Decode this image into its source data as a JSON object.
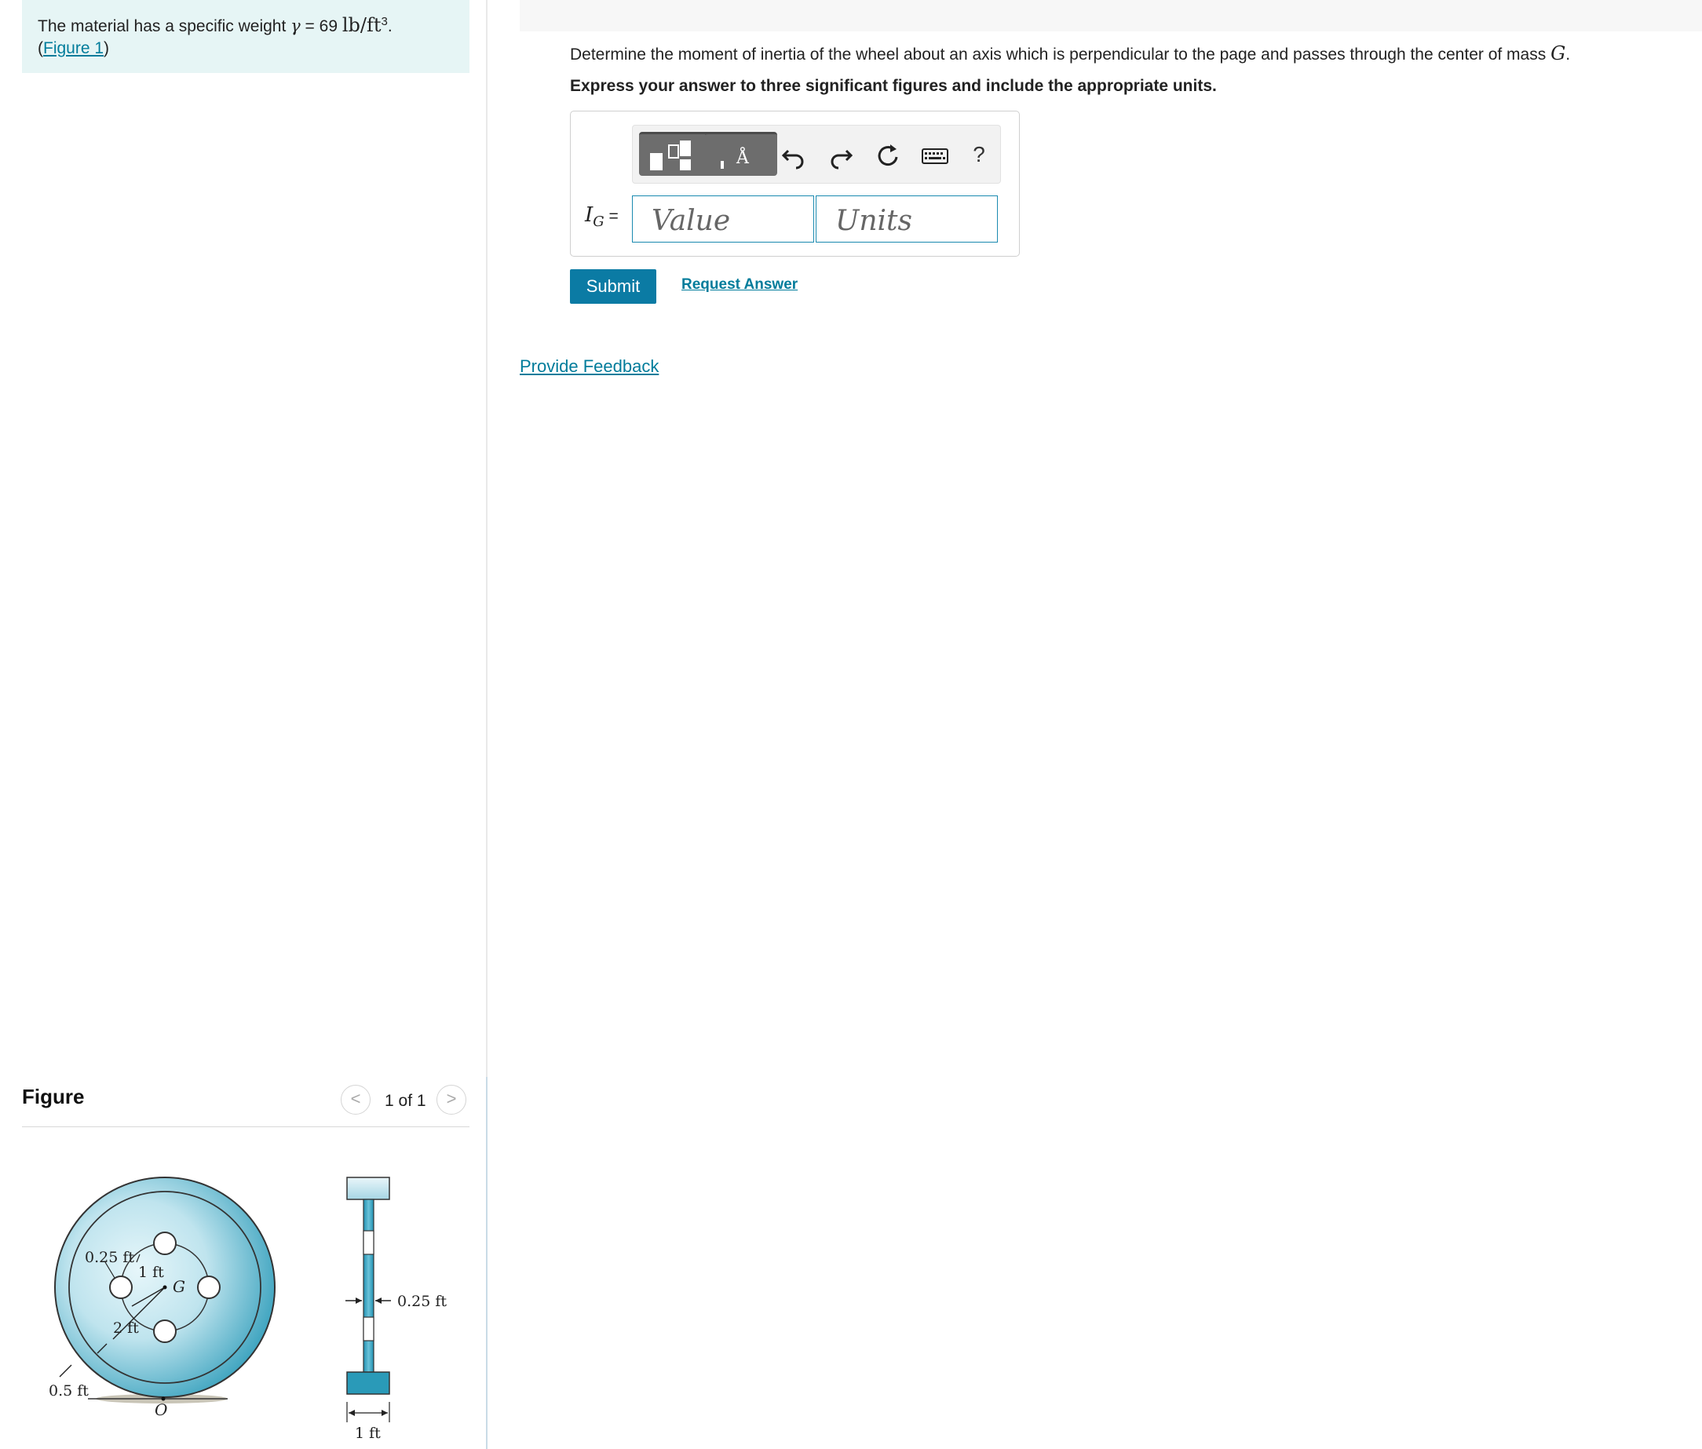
{
  "problem": {
    "text_prefix": "The material has a specific weight ",
    "gamma_symbol": "γ",
    "gamma_value": " = 69 ",
    "gamma_unit": "lb/ft",
    "gamma_exponent": "3",
    "period": ".",
    "figure_link_open": "(",
    "figure_link_text": "Figure 1",
    "figure_link_close": ")"
  },
  "question": {
    "text": "Determine the moment of inertia of the wheel about an axis which is perpendicular to the page and passes through the center of mass ",
    "symbol": "G",
    "end": ".",
    "instruction": "Express your answer to three significant figures and include the appropriate units."
  },
  "answer": {
    "label_main": "I",
    "label_sub": "G",
    "label_eq": " =",
    "value_placeholder": "Value",
    "units_placeholder": "Units"
  },
  "toolbar": {
    "templates_icon": "templates-icon",
    "units_icon": "units-angstrom-icon",
    "undo_icon": "undo-icon",
    "redo_icon": "redo-icon",
    "reset_icon": "reset-icon",
    "keyboard_icon": "keyboard-icon",
    "help_label": "?",
    "units_glyph": "Å"
  },
  "actions": {
    "submit_label": "Submit",
    "request_answer_label": "Request Answer",
    "feedback_label": "Provide Feedback"
  },
  "figure": {
    "title": "Figure",
    "pager_text": "1 of 1",
    "prev_glyph": "<",
    "next_glyph": ">",
    "labels": {
      "hole_radius": "0.25 ft",
      "hole_circle_radius": "1 ft",
      "center": "G",
      "inner_radius": "2 ft",
      "rim_thickness": "0.5 ft",
      "ground_point": "O",
      "web_thickness": "0.25 ft",
      "rim_width": "1 ft"
    },
    "colors": {
      "wheel_dark": "#2a9ab8",
      "wheel_light": "#e6f6fa",
      "outline": "#333333"
    }
  }
}
